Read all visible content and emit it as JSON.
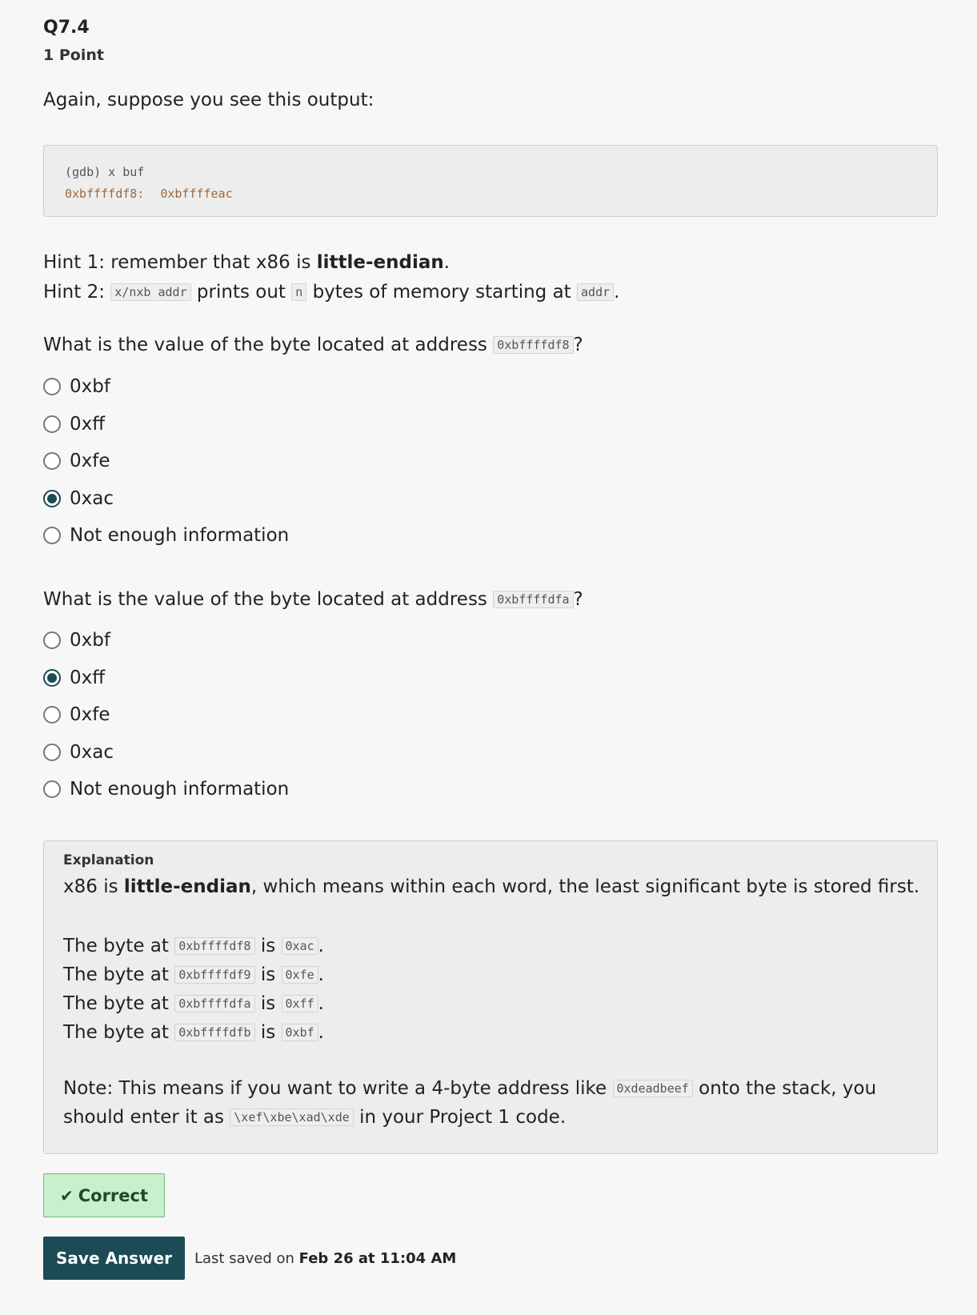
{
  "question": {
    "number": "Q7.4",
    "points": "1 Point",
    "prompt": "Again, suppose you see this output:"
  },
  "gdb_output": {
    "line1": "(gdb) x buf",
    "address": "0xbffffdf8:",
    "value": "0xbffffeac"
  },
  "hints": {
    "hint1_prefix": "Hint 1: remember that x86 is ",
    "hint1_bold": "little-endian",
    "hint1_suffix": ".",
    "hint2_prefix": "Hint 2: ",
    "hint2_code1": "x/nxb addr",
    "hint2_mid1": " prints out ",
    "hint2_code2": "n",
    "hint2_mid2": " bytes of memory starting at ",
    "hint2_code3": "addr",
    "hint2_suffix": "."
  },
  "part1": {
    "question_prefix": "What is the value of the byte located at address ",
    "question_code": "0xbffffdf8",
    "question_suffix": "?",
    "options": [
      "0xbf",
      "0xff",
      "0xfe",
      "0xac",
      "Not enough information"
    ],
    "selected_index": 3
  },
  "part2": {
    "question_prefix": "What is the value of the byte located at address ",
    "question_code": "0xbffffdfa",
    "question_suffix": "?",
    "options": [
      "0xbf",
      "0xff",
      "0xfe",
      "0xac",
      "Not enough information"
    ],
    "selected_index": 1
  },
  "explanation": {
    "title": "Explanation",
    "intro_prefix": "x86 is ",
    "intro_bold": "little-endian",
    "intro_suffix": ", which means within each word, the least significant byte is stored first.",
    "byte_prefix": "The byte at ",
    "byte_is": " is ",
    "byte_suffix": ".",
    "bytes": [
      {
        "addr": "0xbffffdf8",
        "val": "0xac"
      },
      {
        "addr": "0xbffffdf9",
        "val": "0xfe"
      },
      {
        "addr": "0xbffffdfa",
        "val": "0xff"
      },
      {
        "addr": "0xbffffdfb",
        "val": "0xbf"
      }
    ],
    "note_prefix": "Note: This means if you want to write a 4-byte address like ",
    "note_code1": "0xdeadbeef",
    "note_mid": " onto the stack, you",
    "note_line2_prefix": "should enter it as ",
    "note_code2": "\\xef\\xbe\\xad\\xde",
    "note_suffix": " in your Project 1 code."
  },
  "result": {
    "label": "Correct",
    "icon": "checkmark-icon"
  },
  "save": {
    "button_label": "Save Answer",
    "last_saved_prefix": "Last saved on ",
    "last_saved_time": "Feb 26 at 11:04 AM"
  },
  "colors": {
    "accent": "#1c4a55",
    "correct_bg": "#c8f0cd",
    "correct_border": "#6dbd77"
  }
}
